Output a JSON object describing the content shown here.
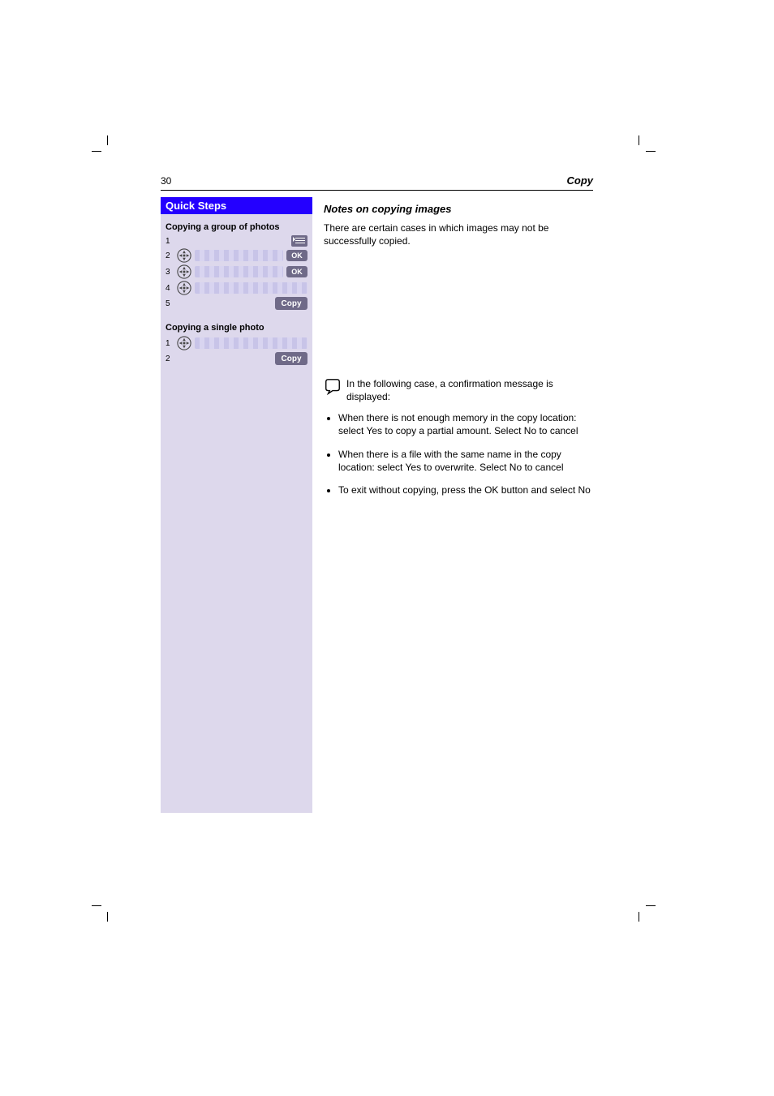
{
  "header": {
    "page_number": "30",
    "section": "Copy"
  },
  "sidebar": {
    "title": "Quick Steps",
    "blocks": [
      {
        "heading": "Copying a group of photos",
        "rows": [
          {
            "num": "1",
            "dpad": false,
            "field": false,
            "menu": true
          },
          {
            "num": "2",
            "dpad": true,
            "field": true,
            "btn": "OK"
          },
          {
            "num": "3",
            "dpad": true,
            "field": true,
            "btn": "OK"
          },
          {
            "num": "4",
            "dpad": true,
            "field": true
          },
          {
            "num": "5",
            "dpad": false,
            "field": false,
            "btn_big": "Copy"
          }
        ]
      },
      {
        "heading": "Copying a single photo",
        "rows": [
          {
            "num": "1",
            "dpad": true,
            "field": true
          },
          {
            "num": "2",
            "dpad": false,
            "field": false,
            "btn_big": "Copy"
          }
        ]
      }
    ]
  },
  "main": {
    "heading": "Notes on copying images",
    "para": "There are certain cases in which images may not be successfully copied.",
    "note_lead": "In the following case, a confirmation message is displayed:",
    "bullets": [
      "When there is not enough memory in the copy location: select Yes to copy a partial amount. Select No to cancel",
      "When there is a file with the same name in the copy location: select Yes to overwrite. Select No to cancel",
      "To exit without copying, press the OK button and select No"
    ]
  }
}
